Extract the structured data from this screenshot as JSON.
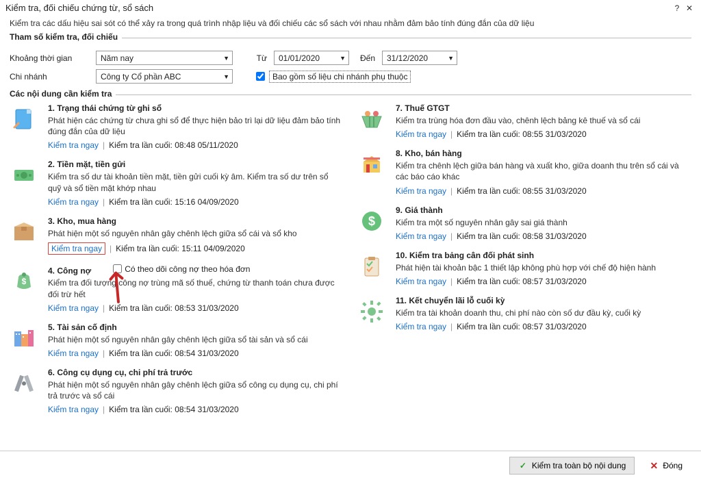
{
  "titlebar": {
    "title": "Kiểm tra, đối chiếu chứng từ, sổ sách"
  },
  "subtitle": "Kiểm tra các dấu hiệu sai sót có thể xảy ra trong quá trình nhập liệu và đối chiếu các sổ sách với nhau nhằm đảm bảo tính đúng đắn của dữ liệu",
  "fieldset_params": "Tham số kiểm tra, đối chiếu",
  "params": {
    "period_label": "Khoảng thời gian",
    "period_value": "Năm nay",
    "from_label": "Từ",
    "from_value": "01/01/2020",
    "to_label": "Đến",
    "to_value": "31/12/2020",
    "branch_label": "Chi nhánh",
    "branch_value": "Công ty Cổ phần ABC",
    "include_label": "Bao gồm số liệu chi nhánh phụ thuộc"
  },
  "fieldset_items": "Các nội dung cần kiểm tra",
  "labels": {
    "check_now": "Kiểm tra ngay",
    "last_check_prefix": "Kiểm tra lần cuối:"
  },
  "left": [
    {
      "title": "1. Trạng thái chứng từ ghi sổ",
      "desc": "Phát hiện các chứng từ chưa ghi sổ để thực hiện bảo trì lại dữ liệu đảm bảo tính đúng đắn của dữ liệu",
      "last": "08:48 05/11/2020",
      "hl": false
    },
    {
      "title": "2. Tiền mặt, tiền gửi",
      "desc": "Kiểm tra số dư tài khoản tiền mặt, tiền gửi cuối kỳ âm. Kiểm tra số dư trên sổ quỹ và sổ tiền mặt khớp nhau",
      "last": "15:16 04/09/2020",
      "hl": false
    },
    {
      "title": "3. Kho, mua hàng",
      "desc": "Phát hiện một số nguyên nhân gây chênh lệch giữa sổ cái và sổ kho",
      "last": "15:11 04/09/2020",
      "hl": true
    },
    {
      "title": "4. Công nợ",
      "desc": "Kiểm tra đối tượng công nợ trùng mã số thuế, chứng từ thanh toán chưa được đối trừ hết",
      "last": "08:53 31/03/2020",
      "hl": false,
      "inline_chk": "Có theo dõi công nợ theo hóa đơn"
    },
    {
      "title": "5. Tài sản cố định",
      "desc": "Phát hiện một số nguyên nhân gây chênh lệch giữa sổ tài sản và sổ cái",
      "last": "08:54 31/03/2020",
      "hl": false
    },
    {
      "title": "6. Công cụ dụng cụ, chi phí trả trước",
      "desc": "Phát hiện một số nguyên nhân gây chênh lệch giữa sổ công cụ dụng cụ, chi phí trả trước và sổ cái",
      "last": "08:54 31/03/2020",
      "hl": false
    }
  ],
  "right": [
    {
      "title": "7. Thuế GTGT",
      "desc": "Kiểm tra trùng hóa đơn đầu vào, chênh lệch bảng kê thuế và sổ cái",
      "last": "08:55 31/03/2020"
    },
    {
      "title": "8. Kho, bán hàng",
      "desc": "Kiểm tra chênh lệch giữa bán hàng và xuất kho, giữa doanh thu trên sổ cái và các báo cáo khác",
      "last": "08:55 31/03/2020"
    },
    {
      "title": "9. Giá thành",
      "desc": "Kiểm tra một số nguyên nhân gây sai giá thành",
      "last": "08:58 31/03/2020"
    },
    {
      "title": "10. Kiểm tra bảng cân đối phát sinh",
      "desc": "Phát hiện tài khoản bậc 1 thiết lập không phù hợp với chế độ hiện hành",
      "last": "08:57 31/03/2020"
    },
    {
      "title": "11. Kết chuyển lãi lỗ cuối kỳ",
      "desc": "Kiểm tra tài khoản doanh thu, chi phí nào còn số dư đầu kỳ, cuối kỳ",
      "last": "08:57 31/03/2020"
    }
  ],
  "footer": {
    "check_all": "Kiểm tra toàn bộ nội dung",
    "close": "Đóng"
  }
}
